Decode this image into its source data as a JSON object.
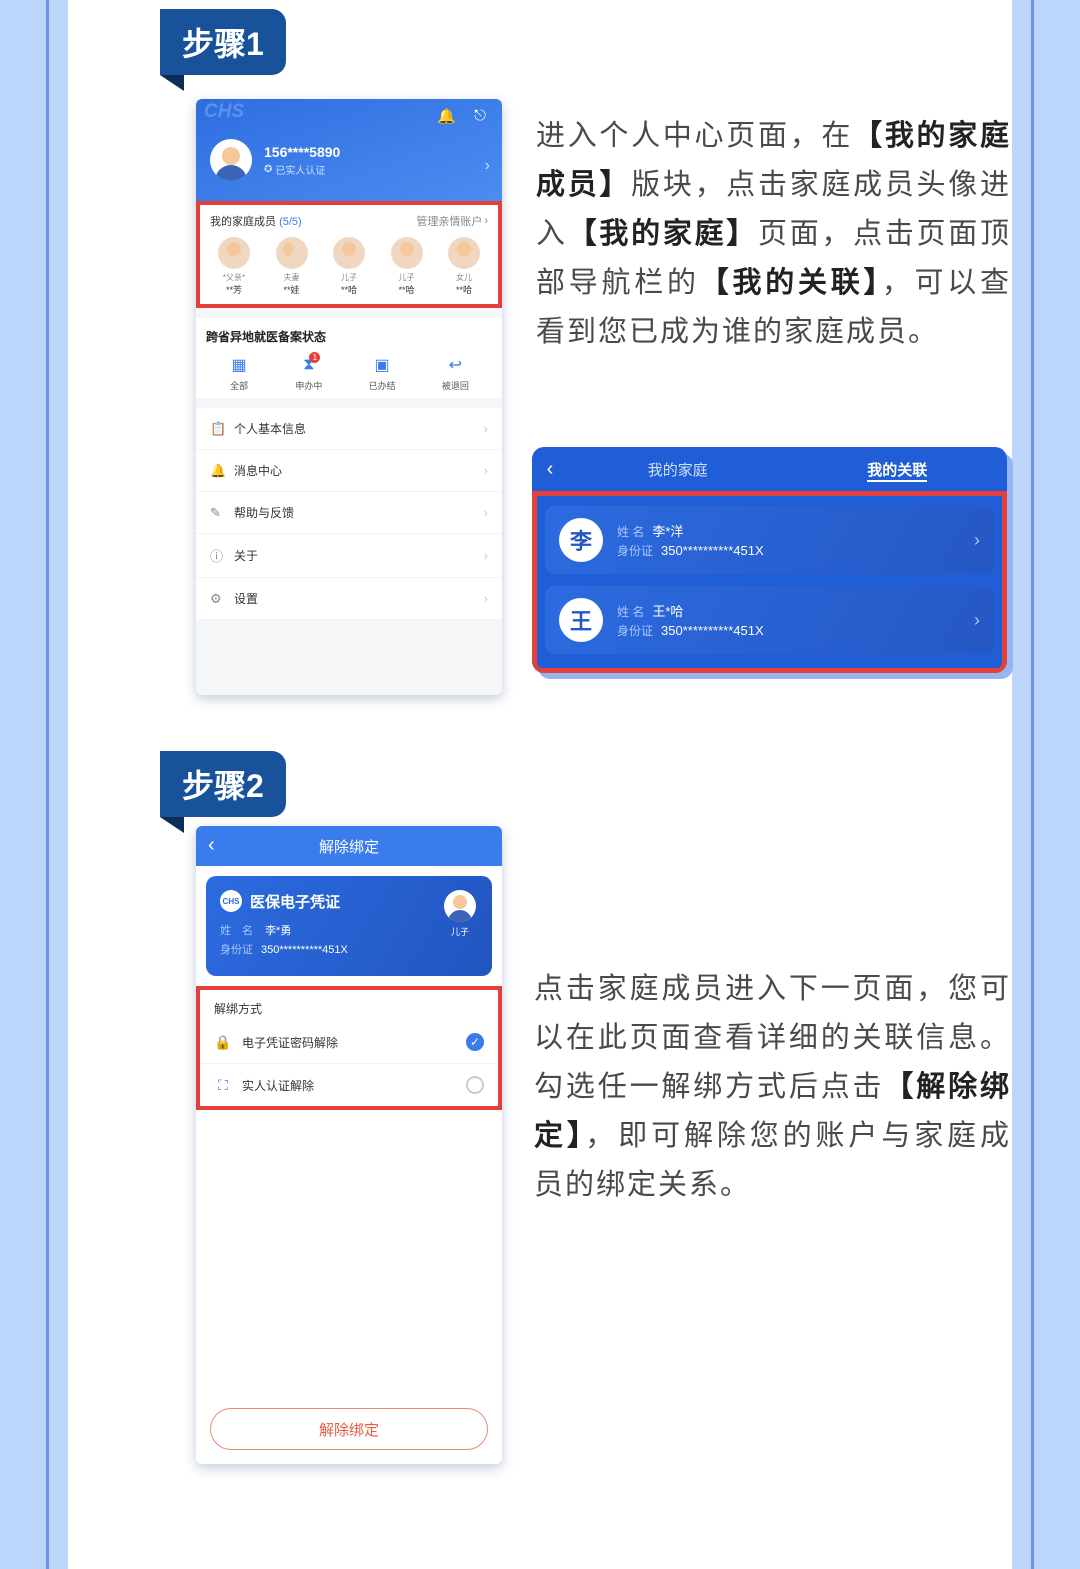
{
  "steps": {
    "s1": {
      "tag": "步骤1"
    },
    "s2": {
      "tag": "步骤2"
    }
  },
  "phone1": {
    "brand": "CHS",
    "phone_masked": "156****5890",
    "verified": "已实人认证",
    "family_section": {
      "title": "我的家庭成员",
      "count": "(5/5)",
      "manage": "管理亲情账户",
      "members": [
        {
          "relation": "*父亲*",
          "name": "**芳"
        },
        {
          "relation": "夫妻",
          "name": "**娃"
        },
        {
          "relation": "儿子",
          "name": "**哈"
        },
        {
          "relation": "儿子",
          "name": "**哈"
        },
        {
          "relation": "女儿",
          "name": "**哈"
        }
      ]
    },
    "status": {
      "title": "跨省异地就医备案状态",
      "items": [
        {
          "label": "全部"
        },
        {
          "label": "申办中",
          "badge": "1"
        },
        {
          "label": "已办结"
        },
        {
          "label": "被退回"
        }
      ]
    },
    "menu": [
      {
        "label": "个人基本信息",
        "icon": "📋"
      },
      {
        "label": "消息中心",
        "icon": "🔔"
      },
      {
        "label": "帮助与反馈",
        "icon": "✎"
      },
      {
        "label": "关于",
        "icon": "ⓘ"
      },
      {
        "label": "设置",
        "icon": "⚙"
      }
    ]
  },
  "step1_text": {
    "t1": "进入个人中心页面，在",
    "b1": "【我的家庭成员】",
    "t2": "版块，点击家庭成员头像进入",
    "b2": "【我的家庭】",
    "t3": "页面，点击页面顶部导航栏的",
    "b3": "【我的关联】",
    "t4": "，可以查看到您已成为谁的家庭成员。"
  },
  "relation_card": {
    "tabs": {
      "family": "我的家庭",
      "related": "我的关联"
    },
    "items": [
      {
        "surname": "李",
        "name": "李*洋",
        "id": "350**********451X"
      },
      {
        "surname": "王",
        "name": "王*哈",
        "id": "350**********451X"
      }
    ],
    "labels": {
      "name": "姓 名",
      "id": "身份证"
    }
  },
  "phone2": {
    "header": "解除绑定",
    "card": {
      "title": "医保电子凭证",
      "name_label": "姓 名",
      "name": "李*勇",
      "id_label": "身份证",
      "id": "350**********451X",
      "relation": "儿子"
    },
    "methods_title": "解绑方式",
    "options": [
      {
        "label": "电子凭证密码解除",
        "checked": true
      },
      {
        "label": "实人认证解除",
        "checked": false
      }
    ],
    "button": "解除绑定"
  },
  "step2_text": {
    "t1": "点击家庭成员进入下一页面，您可以在此页面查看详细的关联信息。勾选任一解绑方式后点击",
    "b1": "【解除绑定】",
    "t2": "，即可解除您的账户与家庭成员的绑定关系。"
  }
}
